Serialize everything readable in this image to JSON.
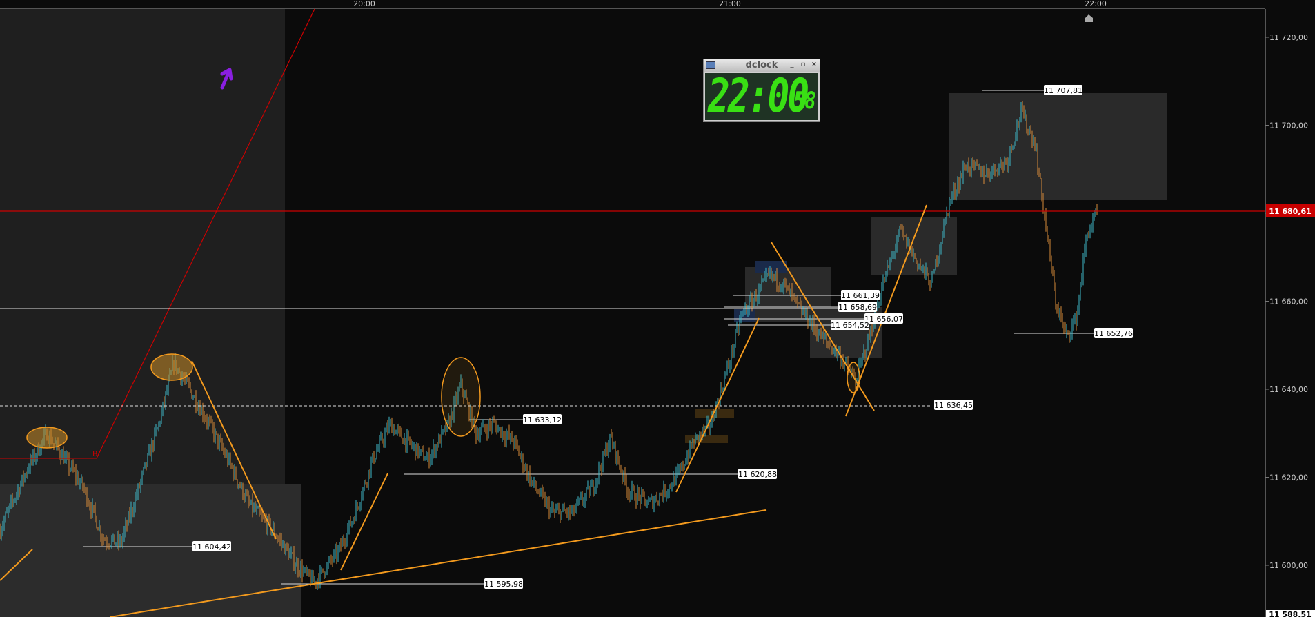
{
  "chart_data": {
    "type": "candlestick",
    "time_axis": [
      "20:00",
      "21:00",
      "22:00"
    ],
    "price_axis": [
      "11 720,00",
      "11 700,00",
      "11 680,00",
      "11 660,00",
      "11 640,00",
      "11 620,00",
      "11 600,00"
    ],
    "ylim": [
      11588.51,
      11725
    ],
    "current_price": "11 680,61",
    "bottom_price": "11 588,51",
    "price_tags": [
      {
        "label": "11 707,81",
        "value": 11707.81
      },
      {
        "label": "11 661,39",
        "value": 11661.39
      },
      {
        "label": "11 658,69",
        "value": 11658.69
      },
      {
        "label": "11 656,07",
        "value": 11656.07
      },
      {
        "label": "11 654,52",
        "value": 11654.52
      },
      {
        "label": "11 652,76",
        "value": 11652.76
      },
      {
        "label": "11 636,45",
        "value": 11636.45
      },
      {
        "label": "11 633,12",
        "value": 11633.12
      },
      {
        "label": "11 620,88",
        "value": 11620.88
      },
      {
        "label": "11 604,42",
        "value": 11604.42
      },
      {
        "label": "11 595,98",
        "value": 11595.98
      }
    ],
    "marker_letter": "B",
    "colors": {
      "background": "#0b0b0b",
      "up_candle": "#3fb8c8",
      "down_candle": "#d78b3a",
      "trendline": "#f39a1e",
      "current_price_line": "#cc0000",
      "arrow": "#8a1fe0"
    }
  },
  "dclock": {
    "title": "dclock",
    "time": "22:00",
    "seconds": "58"
  }
}
